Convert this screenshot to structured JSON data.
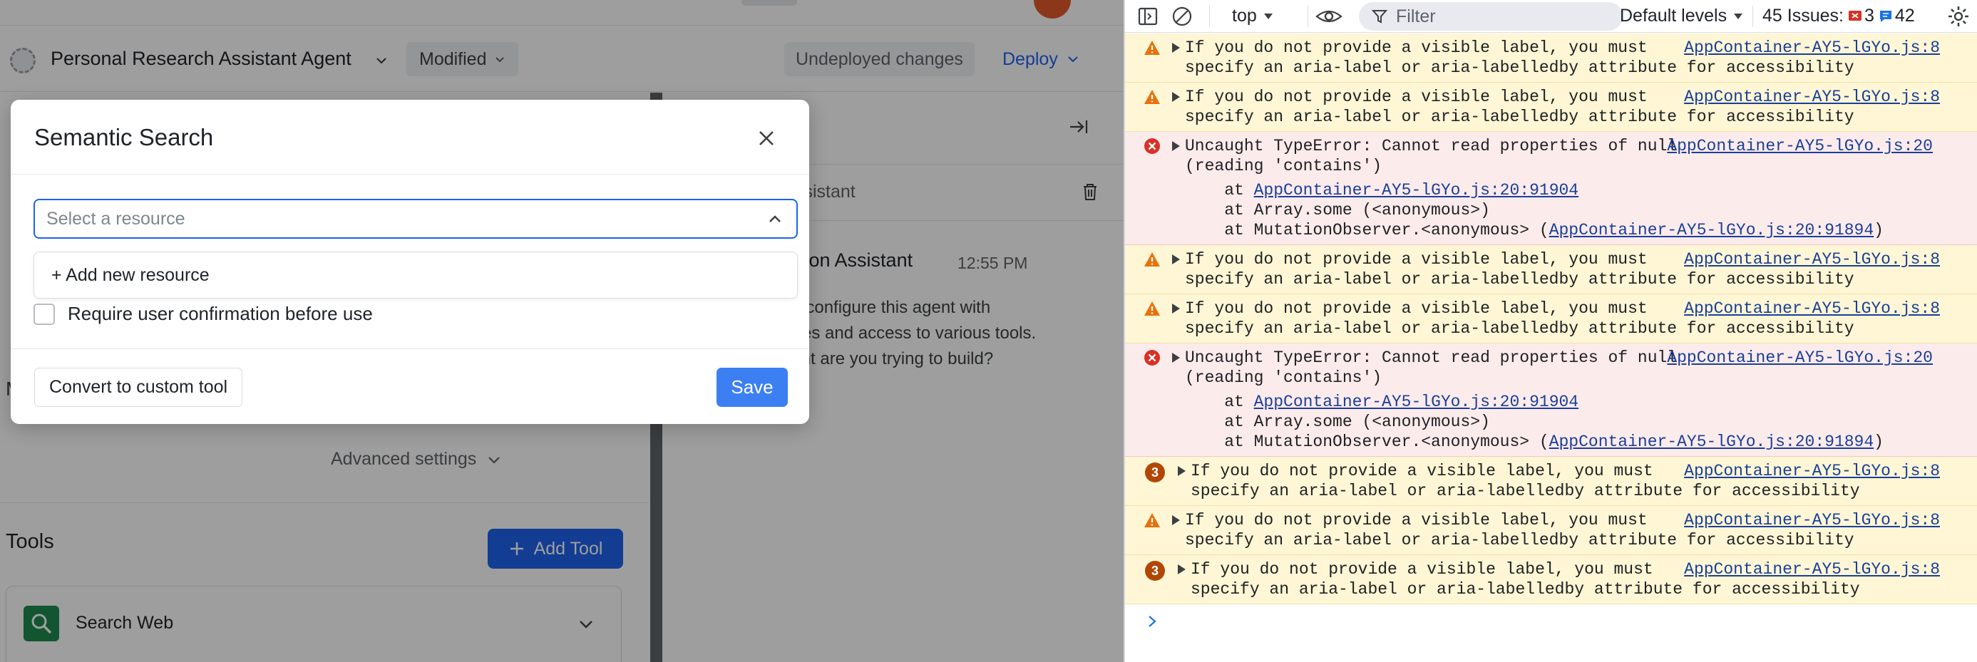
{
  "app": {
    "agent_name": "Personal Research Assistant Agent",
    "status_pill": "Modified",
    "undeployed_label": "Undeployed changes",
    "deploy_label": "Deploy",
    "left_panel": {
      "partial_label": "M",
      "advanced_settings_label": "Advanced settings",
      "tools_title": "Tools",
      "add_tool_label": "Add Tool",
      "tool_item_name": "Search Web"
    },
    "right_panel": {
      "conversation_label": "ssistant",
      "message_author": "ration Assistant",
      "message_time": "12:55 PM",
      "message_lines": [
        "ou configure this agent with",
        "ilities and access to various tools.",
        "gent are you trying to build?"
      ]
    }
  },
  "modal": {
    "title": "Semantic Search",
    "resource_placeholder": "Select a resource",
    "add_resource_label": "+ Add new resource",
    "confirm_label": "Require user confirmation before use",
    "confirm_checked": false,
    "convert_label": "Convert to custom tool",
    "save_label": "Save"
  },
  "devtools": {
    "context_label": "top",
    "filter_placeholder": "Filter",
    "levels_label": "Default levels",
    "issues_label": "45 Issues:",
    "error_issue_count": "3",
    "info_issue_count": "42",
    "messages": [
      {
        "kind": "warn",
        "text": "If you do not provide a visible label, you must\nspecify an aria-label or aria-labelledby attribute for accessibility",
        "source": "AppContainer-AY5-lGYo.js:8"
      },
      {
        "kind": "warn",
        "text": "If you do not provide a visible label, you must\nspecify an aria-label or aria-labelledby attribute for accessibility",
        "source": "AppContainer-AY5-lGYo.js:8"
      },
      {
        "kind": "err",
        "text": "Uncaught TypeError: Cannot read properties of null\n(reading 'contains')",
        "source": "AppContainer-AY5-lGYo.js:20",
        "stack": [
          {
            "prefix": "    at ",
            "link": "AppContainer-AY5-lGYo.js:20:91904",
            "suffix": ""
          },
          {
            "prefix": "    at Array.some (<anonymous>)",
            "link": "",
            "suffix": ""
          },
          {
            "prefix": "    at MutationObserver.<anonymous> (",
            "link": "AppContainer-AY5-lGYo.js:20:91894",
            "suffix": ")"
          }
        ]
      },
      {
        "kind": "warn",
        "text": "If you do not provide a visible label, you must\nspecify an aria-label or aria-labelledby attribute for accessibility",
        "source": "AppContainer-AY5-lGYo.js:8"
      },
      {
        "kind": "warn",
        "text": "If you do not provide a visible label, you must\nspecify an aria-label or aria-labelledby attribute for accessibility",
        "source": "AppContainer-AY5-lGYo.js:8"
      },
      {
        "kind": "err",
        "text": "Uncaught TypeError: Cannot read properties of null\n(reading 'contains')",
        "source": "AppContainer-AY5-lGYo.js:20",
        "stack": [
          {
            "prefix": "    at ",
            "link": "AppContainer-AY5-lGYo.js:20:91904",
            "suffix": ""
          },
          {
            "prefix": "    at Array.some (<anonymous>)",
            "link": "",
            "suffix": ""
          },
          {
            "prefix": "    at MutationObserver.<anonymous> (",
            "link": "AppContainer-AY5-lGYo.js:20:91894",
            "suffix": ")"
          }
        ]
      },
      {
        "kind": "warn",
        "count": "3",
        "text": "If you do not provide a visible label, you must\nspecify an aria-label or aria-labelledby attribute for accessibility",
        "source": "AppContainer-AY5-lGYo.js:8"
      },
      {
        "kind": "warn",
        "text": "If you do not provide a visible label, you must\nspecify an aria-label or aria-labelledby attribute for accessibility",
        "source": "AppContainer-AY5-lGYo.js:8"
      },
      {
        "kind": "warn",
        "count": "3",
        "text": "If you do not provide a visible label, you must\nspecify an aria-label or aria-labelledby attribute for accessibility",
        "source": "AppContainer-AY5-lGYo.js:8"
      }
    ]
  },
  "colors": {
    "accent": "#1d63ed",
    "save": "#3b7ff2",
    "warn_bg": "#fef6d5",
    "error_bg": "#fcebeb",
    "error_icon": "#d93025",
    "warn_icon": "#e8710a"
  }
}
